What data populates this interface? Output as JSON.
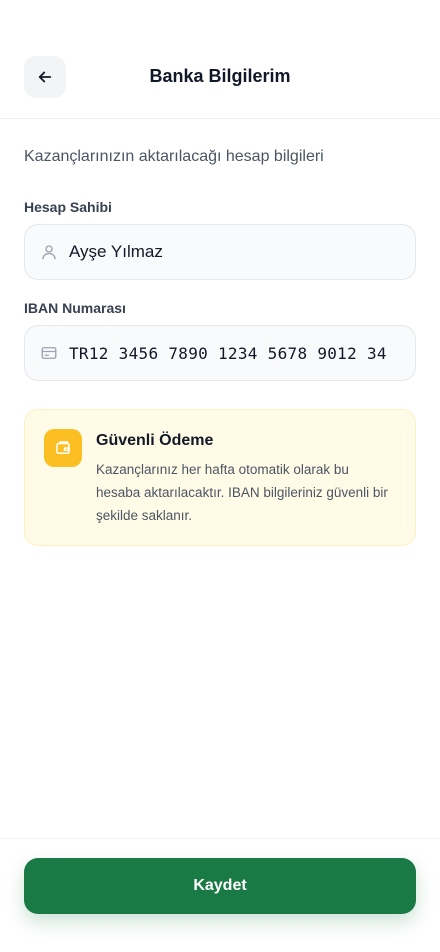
{
  "header": {
    "title": "Banka Bilgilerim",
    "back_icon": "arrow-left-icon"
  },
  "subtitle": "Kazançlarınızın aktarılacağı hesap bilgileri",
  "account_holder": {
    "label": "Hesap Sahibi",
    "value": "Ayşe Yılmaz",
    "icon": "user-icon"
  },
  "iban": {
    "label": "IBAN Numarası",
    "value": "TR12 3456 7890 1234 5678 9012 34",
    "icon": "card-icon"
  },
  "info": {
    "title": "Güvenli Ödeme",
    "body": "Kazançlarınız her hafta otomatik olarak bu hesaba aktarılacaktır. IBAN bilgileriniz güvenli bir şekilde saklanır.",
    "icon": "wallet-icon",
    "accent": "#fbbf24"
  },
  "footer": {
    "save_label": "Kaydet",
    "accent": "#1a7a45"
  }
}
